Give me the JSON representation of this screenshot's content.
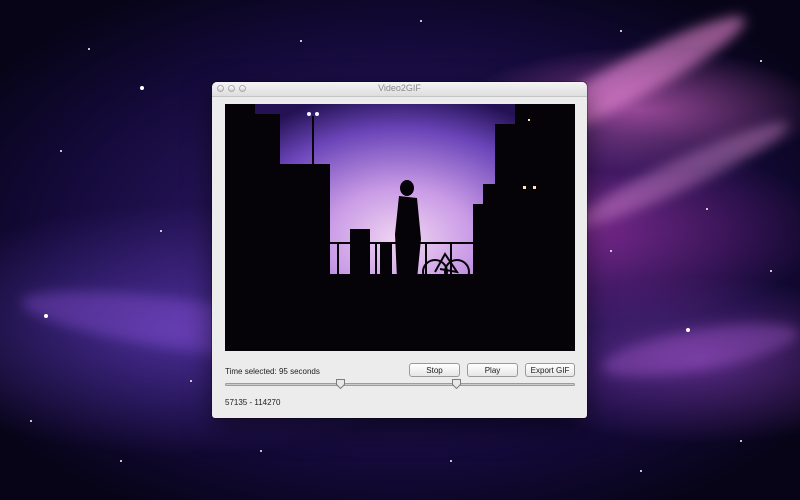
{
  "window": {
    "title": "Video2GIF"
  },
  "selection": {
    "time_selected": "Time selected: 95 seconds",
    "range": "57135 - 114270"
  },
  "buttons": {
    "stop": "Stop",
    "play": "Play",
    "export": "Export GIF"
  },
  "slider": {
    "start_fraction": 0.33,
    "end_fraction": 0.66
  },
  "icons": {
    "close": "close-icon",
    "minimize": "minimize-icon",
    "zoom": "zoom-icon"
  },
  "colors": {
    "desktop_base": "#140a3a",
    "desktop_pink": "#c83cbe",
    "window_bg": "#ececec",
    "video_sky": "#c79de8"
  }
}
